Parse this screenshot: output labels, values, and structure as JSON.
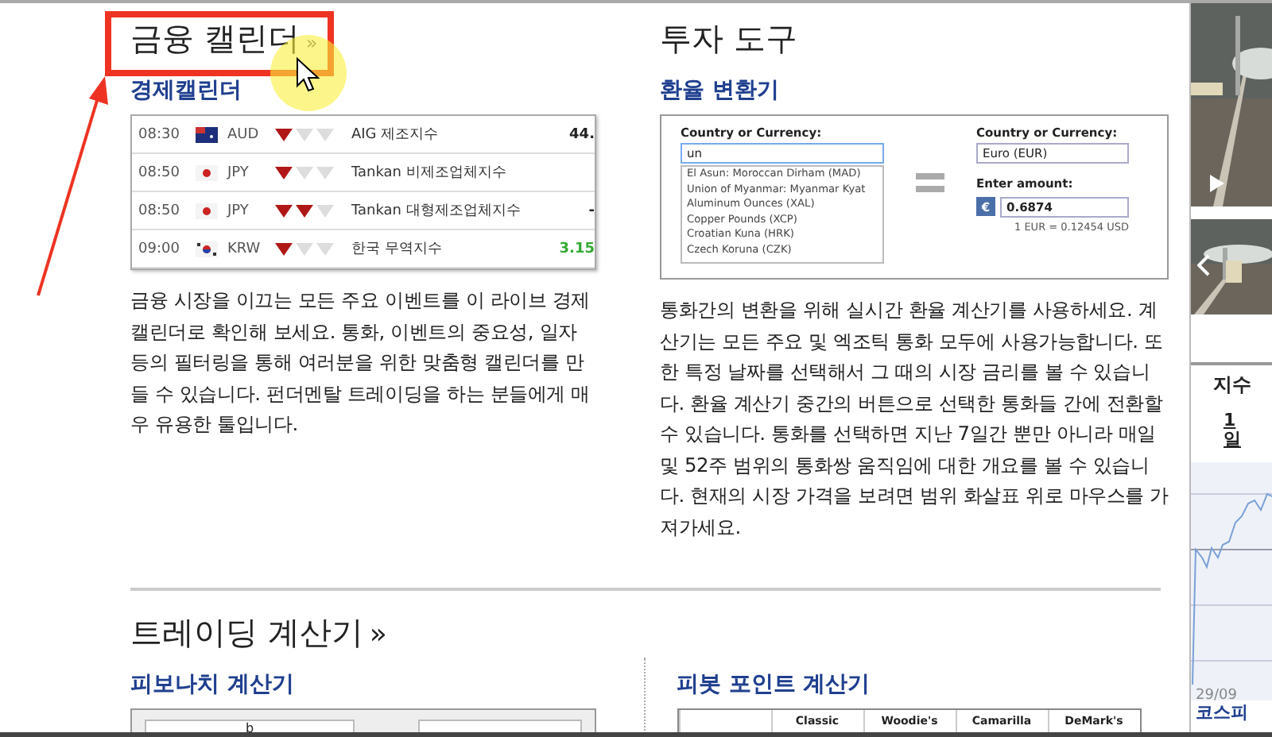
{
  "top_columns": [
    {
      "kind": "calendar",
      "heading": "금융 캘린더",
      "more": "»",
      "subtitle": "경제캘린더",
      "rows": [
        {
          "kind": "au",
          "time": "08:30",
          "currency": "AUD",
          "stars": 1,
          "event": "AIG 제조지수",
          "value": "44.",
          "color": "#222222"
        },
        {
          "kind": "jp",
          "time": "08:50",
          "currency": "JPY",
          "stars": 1,
          "event": "Tankan 비제조업체지수"
        },
        {
          "kind": "jp",
          "time": "08:50",
          "currency": "JPY",
          "stars": 2,
          "event": "Tankan 대형제조업체지수",
          "value": "-",
          "color": "#222222"
        },
        {
          "kind": "kr",
          "time": "09:00",
          "currency": "KRW",
          "stars": 1,
          "event": "한국 무역지수",
          "value": "3.15",
          "color": "#33aa33"
        }
      ],
      "description": "금융 시장을 이끄는 모든 주요 이벤트를 이 라이브 경제 캘린더로 확인해 보세요. 통화, 이벤트의 중요성, 일자 등의 필터링을 통해 여러분을 위한 맞춤형 캘린더를 만들 수 있습니다. 펀더멘탈 트레이딩을 하는 분들에게 매우 유용한 툴입니다."
    },
    {
      "kind": "converter",
      "heading": "투자 도구",
      "subtitle": "환율 변환기",
      "from_label": "Country or Currency:",
      "from_value": "un",
      "options": [
        "El Asun: Moroccan Dirham (MAD)",
        "Union of Myanmar: Myanmar Kyat",
        "Aluminum Ounces (XAL)",
        "Copper Pounds (XCP)",
        "Croatian Kuna (HRK)",
        "Czech Koruna (CZK)"
      ],
      "to_label": "Country or Currency:",
      "to_value": "Euro (EUR)",
      "amount_label": "Enter amount:",
      "currency_symbol": "€",
      "amount": "0.6874",
      "rate": "1 EUR = 0.12454 USD",
      "description": "통화간의 변환을 위해 실시간 환율 계산기를 사용하세요. 계산기는 모든 주요 및 엑조틱 통화 모두에 사용가능합니다. 또한 특정 날짜를 선택해서 그 때의 시장 금리를 볼 수 있습니다. 환율 계산기 중간의 버튼으로 선택한 통화들 간에 전환할 수 있습니다. 통화를 선택하면 지난 7일간 뿐만 아니라 매일 및 52주 범위의 통화쌍 움직임에 대한 개요를 볼 수 있습니다. 현재의 시장 가격을 보려면 범위 화살표 위로 마우스를 가져가세요."
    }
  ],
  "trading": {
    "heading": "트레이딩 계산기",
    "more": "»",
    "columns": [
      {
        "kind": "fibonacci",
        "subtitle": "피보나치 계산기",
        "label": "b"
      },
      {
        "kind": "pivot",
        "subtitle": "피봇 포인트 계산기",
        "headers": [
          "Classic",
          "Woodie's",
          "Camarilla",
          "DeMark's"
        ]
      }
    ]
  },
  "side": {
    "title": "지수",
    "period": "1일",
    "date": "29/09",
    "index_name": "코스피"
  }
}
